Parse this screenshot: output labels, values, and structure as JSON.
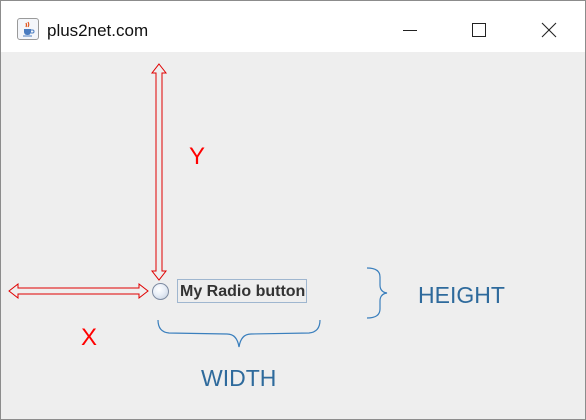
{
  "window": {
    "title": "plus2net.com",
    "icon": "java-coffee-cup-icon"
  },
  "controls": {
    "minimize_icon": "minimize-icon",
    "maximize_icon": "maximize-icon",
    "close_icon": "close-icon"
  },
  "radio": {
    "label": "My Radio button",
    "checked": false
  },
  "annotations": {
    "y": "Y",
    "x": "X",
    "height": "HEIGHT",
    "width": "WIDTH"
  },
  "colors": {
    "red_annotation": "#ff0000",
    "blue_annotation": "#2e6a9c",
    "window_background": "#eeeeee"
  }
}
